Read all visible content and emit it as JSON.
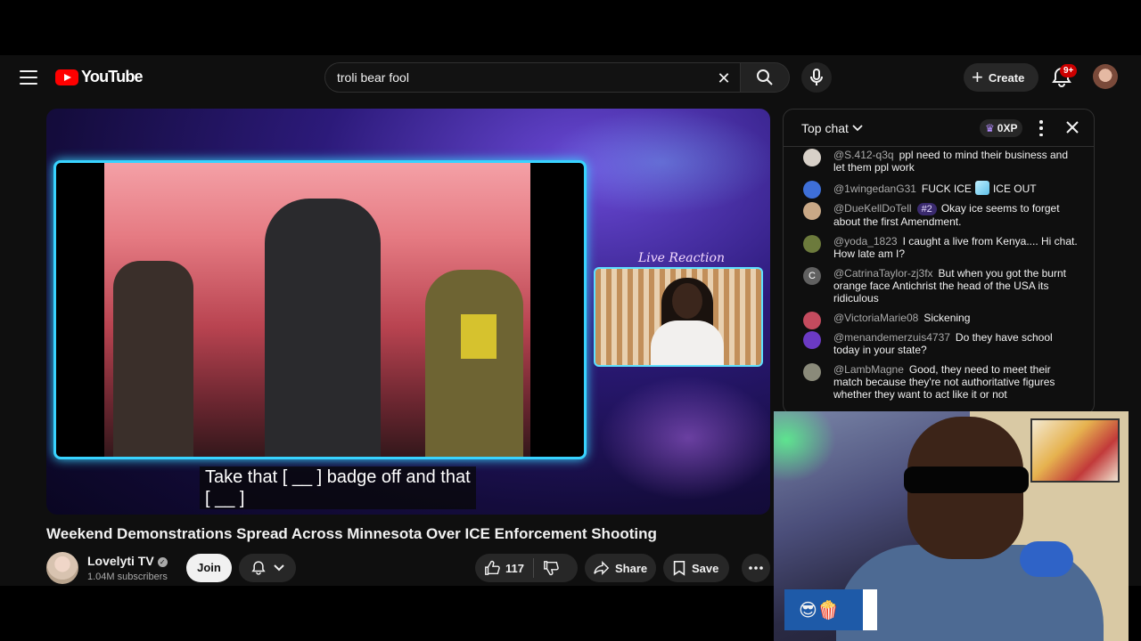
{
  "header": {
    "logo_text": "YouTube",
    "search_value": "troli bear fool",
    "create_label": "Create",
    "notification_count": "9+"
  },
  "video": {
    "caption_line1": "Take that [ __ ] badge off and that",
    "caption_line2": "[ __ ]",
    "overlay_label": "Live Reaction",
    "title": "Weekend Demonstrations Spread Across Minnesota Over ICE Enforcement Shooting"
  },
  "channel": {
    "name": "Lovelyti TV",
    "subscribers": "1.04M subscribers",
    "join_label": "Join"
  },
  "actions": {
    "like_count": "117",
    "share_label": "Share",
    "save_label": "Save"
  },
  "chat": {
    "mode_label": "Top chat",
    "xp_label": "0XP",
    "messages": [
      {
        "author": "@S.412-q3q",
        "text": "ppl need to mind their business and let them ppl work",
        "avatar_color": "#d7d0c8"
      },
      {
        "author": "@1wingedanG31",
        "text": "FUCK ICE",
        "text_after": "ICE OUT",
        "avatar_color": "#3e6fd8"
      },
      {
        "author": "@DueKellDoTell",
        "rank": "#2",
        "text": "Okay ice seems to forget about the first Amendment.",
        "avatar_color": "#c9a886"
      },
      {
        "author": "@yoda_1823",
        "text": "I caught a live from Kenya.... Hi chat. How late am I?",
        "avatar_color": "#6c7a3c"
      },
      {
        "author": "@CatrinaTaylor-zj3fx",
        "text": "But when you got the burnt orange face Antichrist the head of the USA its ridiculous",
        "avatar_letter": "C",
        "avatar_color": "#606060"
      },
      {
        "author": "@VictoriaMarie08",
        "text": "Sickening",
        "avatar_color": "#c44b5e"
      },
      {
        "author": "@menandemerzuis4737",
        "text": "Do they have school today in your state?",
        "avatar_color": "#6b3ac4"
      },
      {
        "author": "@LambMagne",
        "text": "Good, they need to meet their match because they're not authoritative figures whether they want to act like it or not",
        "avatar_color": "#8a8a7a"
      }
    ]
  },
  "stream_overlay": {
    "emojis": "😎🍿"
  }
}
